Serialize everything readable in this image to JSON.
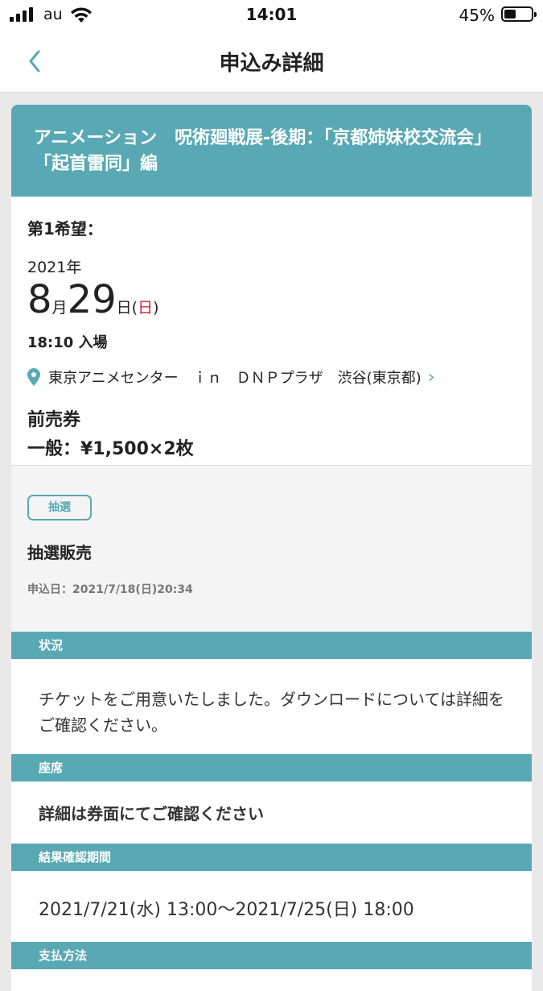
{
  "status_bar": {
    "carrier": "au",
    "time": "14:01",
    "battery_percent": "45%",
    "battery_level": 0.45
  },
  "nav": {
    "title": "申込み詳細",
    "back_icon": "chevron-left-icon"
  },
  "event": {
    "title": "アニメーション　呪術廻戦展-後期：「京都姉妹校交流会」「起首雷同」編"
  },
  "detail": {
    "choice_label": "第1希望：",
    "year": "2021年",
    "month": "8",
    "month_unit": "月",
    "day": "29",
    "day_unit": "日",
    "paren_open": "(",
    "weekday": "日",
    "paren_close": ")",
    "entry": "18:10 入場",
    "venue": "東京アニメセンター　ｉｎ　ＤＮＰプラザ　渋谷(東京都)",
    "ticket_type": "前売券",
    "ticket_price": "一般：¥1,500×2枚"
  },
  "lottery": {
    "badge": "抽選",
    "title": "抽選販売",
    "applied": "申込日：2021/7/18(日)20:34"
  },
  "sections": {
    "status_head": "状況",
    "status_text": "チケットをご用意いたしました。ダウンロードについては詳細をご確認ください。",
    "seat_head": "座席",
    "seat_text": "詳細は券面にてご確認ください",
    "period_head": "結果確認期間",
    "period_text": "2021/7/21(水) 13:00〜2021/7/25(日) 18:00",
    "payment_head": "支払方法"
  },
  "colors": {
    "accent": "#58a9b4",
    "sunday": "#d0262c"
  }
}
